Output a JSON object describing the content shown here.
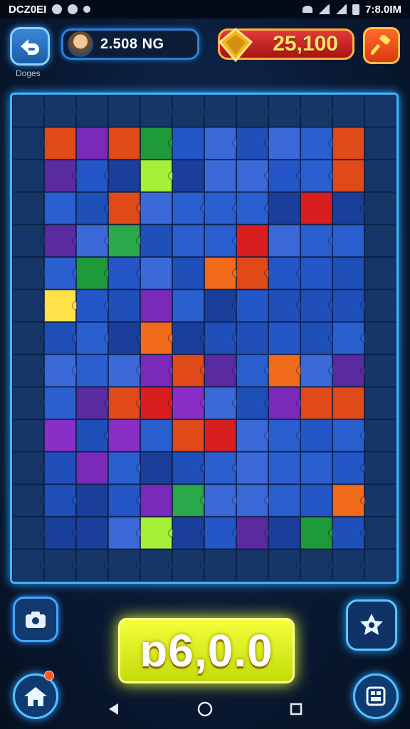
{
  "status_bar": {
    "left_text": "DCZ0EI",
    "time": "7:8.0IM"
  },
  "header": {
    "back_caption": "Doges",
    "player_text": "2.508 NG",
    "coins": "25,100"
  },
  "score": "ɒ6,0.0",
  "icons": {
    "back": "back-arrow-icon",
    "avatar": "avatar",
    "coin": "gold-gem-icon",
    "boost": "hammer-icon",
    "camera": "camera-icon",
    "hint": "puzzle-hint-icon",
    "home": "home-icon",
    "menu": "grid-menu-icon",
    "nav": [
      "back-triangle-icon",
      "home-circle-icon",
      "recents-square-icon"
    ]
  },
  "colors": {
    "board_base": "#1e46a8",
    "board_border": "#3fb7ff",
    "score_panel": "#e8f51a",
    "coin_pill": "#c82020"
  }
}
